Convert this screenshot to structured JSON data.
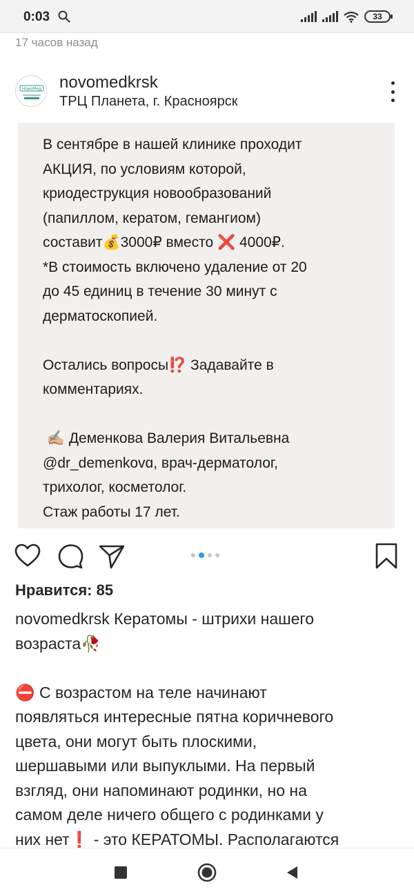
{
  "status_bar": {
    "time": "0:03",
    "battery": "33",
    "icons": [
      "search-icon",
      "signal-icon",
      "signal-icon",
      "wifi-icon",
      "battery-icon"
    ]
  },
  "post": {
    "time_ago": "17 часов назад",
    "username": "novomedkrsk",
    "location": "ТРЦ Планета, г. Красноярск",
    "avatar_text": "НовоМед",
    "image_text": "В сентябре в нашей клинике проходит\nАКЦИЯ, по условиям которой,\nкриодеструкция новообразований\n(папиллом, кератом, гемангиом)\nсоставит💰3000₽ вместо ❌ 4000₽.\n*В стоимость включено удаление от 20\nдо 45 единиц в течение 30 минут с\nдерматоскопией.\n\nОстались вопросы⁉️ Задавайте в\nкомментариях.\n\n ✍🏼 Деменкова Валерия Витальевна\n@dr_demenkovɑ, врач-дерматолог,\nтрихолог, косметолог.\nСтаж работы 17 лет.",
    "likes": "Нравится: 85",
    "caption_username": "novomedkrsk",
    "caption_text": " Кератомы - штрихи нашего\nвозраста🥀\n\n⛔ С возрастом на теле начинают\nпоявляться интересные пятна коричневого\nцвета, они могут быть плоскими,\nшершавыми или выпуклыми. На первый\nвзгляд, они напоминают родинки, но на\nсамом деле ничего общего с родинками у\nних нет❗ - это КЕРАТОМЫ. Располагаются",
    "carousel": {
      "count": 4,
      "active": 1
    }
  },
  "actions": {
    "icons": [
      "heart-icon",
      "comment-icon",
      "share-icon",
      "bookmark-icon"
    ]
  },
  "nav": {
    "icons": [
      "recent-apps-icon",
      "home-icon",
      "back-icon"
    ]
  },
  "colors": {
    "accent": "#3897f0",
    "image_bg": "#f2f0ee",
    "text": "#262626",
    "muted": "#8e8e8e"
  }
}
